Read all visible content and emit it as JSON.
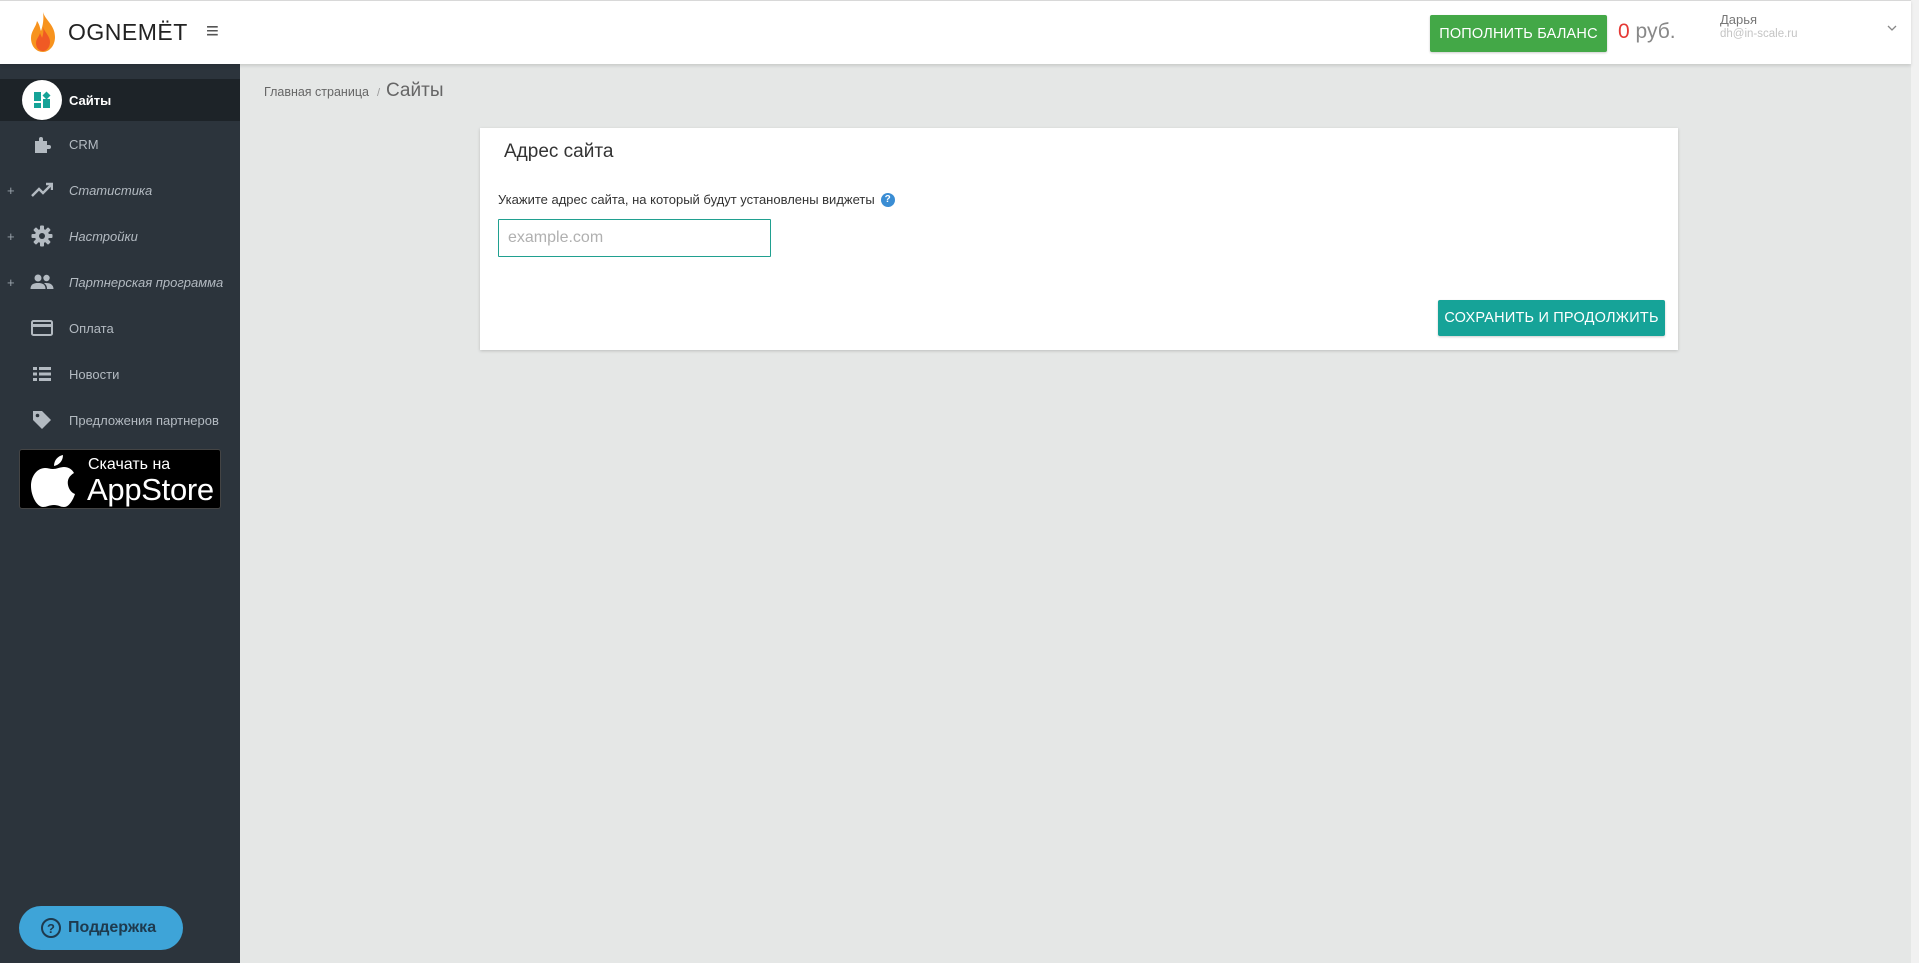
{
  "header": {
    "logo_text": "OGNEMËT",
    "topup_label": "ПОПОЛНИТЬ БАЛАНС",
    "balance_amount": "0",
    "balance_currency": " руб.",
    "user_name": "Дарья",
    "user_email": "dh@in-scale.ru"
  },
  "sidebar": {
    "items": [
      {
        "label": "Сайты",
        "icon": "dashboard-icon",
        "active": true,
        "expandable": false
      },
      {
        "label": "CRM",
        "icon": "puzzle-icon",
        "active": false,
        "expandable": false
      },
      {
        "label": "Статистика",
        "icon": "trending-up-icon",
        "active": false,
        "expandable": true
      },
      {
        "label": "Настройки",
        "icon": "gear-icon",
        "active": false,
        "expandable": true
      },
      {
        "label": "Партнерская программа",
        "icon": "people-icon",
        "active": false,
        "expandable": true
      },
      {
        "label": "Оплата",
        "icon": "credit-card-icon",
        "active": false,
        "expandable": false
      },
      {
        "label": "Новости",
        "icon": "list-icon",
        "active": false,
        "expandable": false
      },
      {
        "label": "Предложения партнеров",
        "icon": "tag-icon",
        "active": false,
        "expandable": false
      }
    ],
    "expand_symbol": "+",
    "appstore_small": "Скачать на",
    "appstore_big": "AppStore",
    "support_label": "Поддержка",
    "support_icon_glyph": "?"
  },
  "breadcrumb": {
    "home": "Главная страница",
    "separator": "/",
    "current": "Сайты"
  },
  "card": {
    "title": "Адрес сайта",
    "field_label": "Укажите адрес сайта, на который будут установлены виджеты",
    "help_glyph": "?",
    "input_value": "",
    "input_placeholder": "example.com",
    "save_label": "СОХРАНИТЬ И ПРОДОЛЖИТЬ"
  },
  "colors": {
    "sidebar_bg": "#2c343c",
    "topup_green": "#43a847",
    "save_teal": "#16a398",
    "balance_red": "#e53935",
    "support_blue": "#3ea4d8"
  }
}
